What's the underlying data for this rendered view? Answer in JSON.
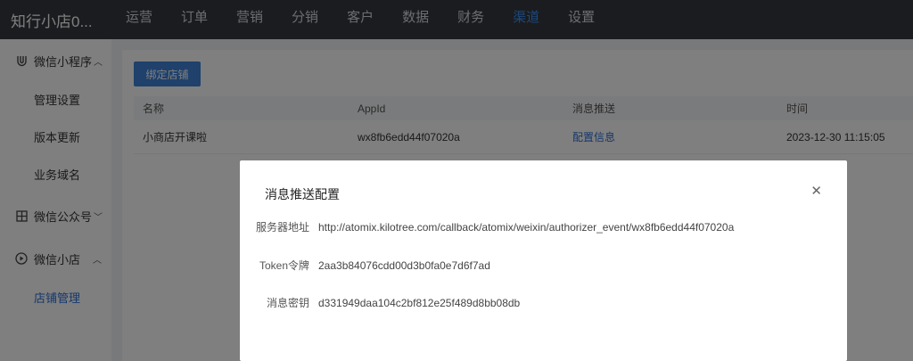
{
  "header": {
    "brand": "知行小店0...",
    "nav": [
      "运营",
      "订单",
      "营销",
      "分销",
      "客户",
      "数据",
      "财务",
      "渠道",
      "设置"
    ],
    "active_index": 7
  },
  "sidebar": {
    "groups": [
      {
        "label": "微信小程序",
        "icon": "magnet-icon",
        "expanded": true,
        "items": [
          "管理设置",
          "版本更新",
          "业务域名"
        ]
      },
      {
        "label": "微信公众号",
        "icon": "grid-icon",
        "expanded": false,
        "items": []
      },
      {
        "label": "微信小店",
        "icon": "play-circle-icon",
        "expanded": true,
        "items": [
          "店铺管理"
        ],
        "active_item": "店铺管理"
      }
    ]
  },
  "main": {
    "bind_button": "绑定店铺",
    "table": {
      "headers": [
        "名称",
        "AppId",
        "消息推送",
        "时间"
      ],
      "rows": [
        [
          "小商店开课啦",
          "wx8fb6edd44f07020a",
          "配置信息",
          "2023-12-30 11:15:05"
        ]
      ]
    }
  },
  "dialog": {
    "title": "消息推送配置",
    "fields": [
      {
        "label": "服务器地址",
        "value": "http://atomix.kilotree.com/callback/atomix/weixin/authorizer_event/wx8fb6edd44f07020a"
      },
      {
        "label": "Token令牌",
        "value": "2aa3b84076cdd00d3b0fa0e7d6f7ad"
      },
      {
        "label": "消息密钥",
        "value": "d331949daa104c2bf812e25f489d8bb08db"
      }
    ]
  },
  "colors": {
    "accent": "#3e8ef7",
    "topbar": "#34393f",
    "primary_button": "#3e82d8",
    "link": "#2d6fd6"
  }
}
